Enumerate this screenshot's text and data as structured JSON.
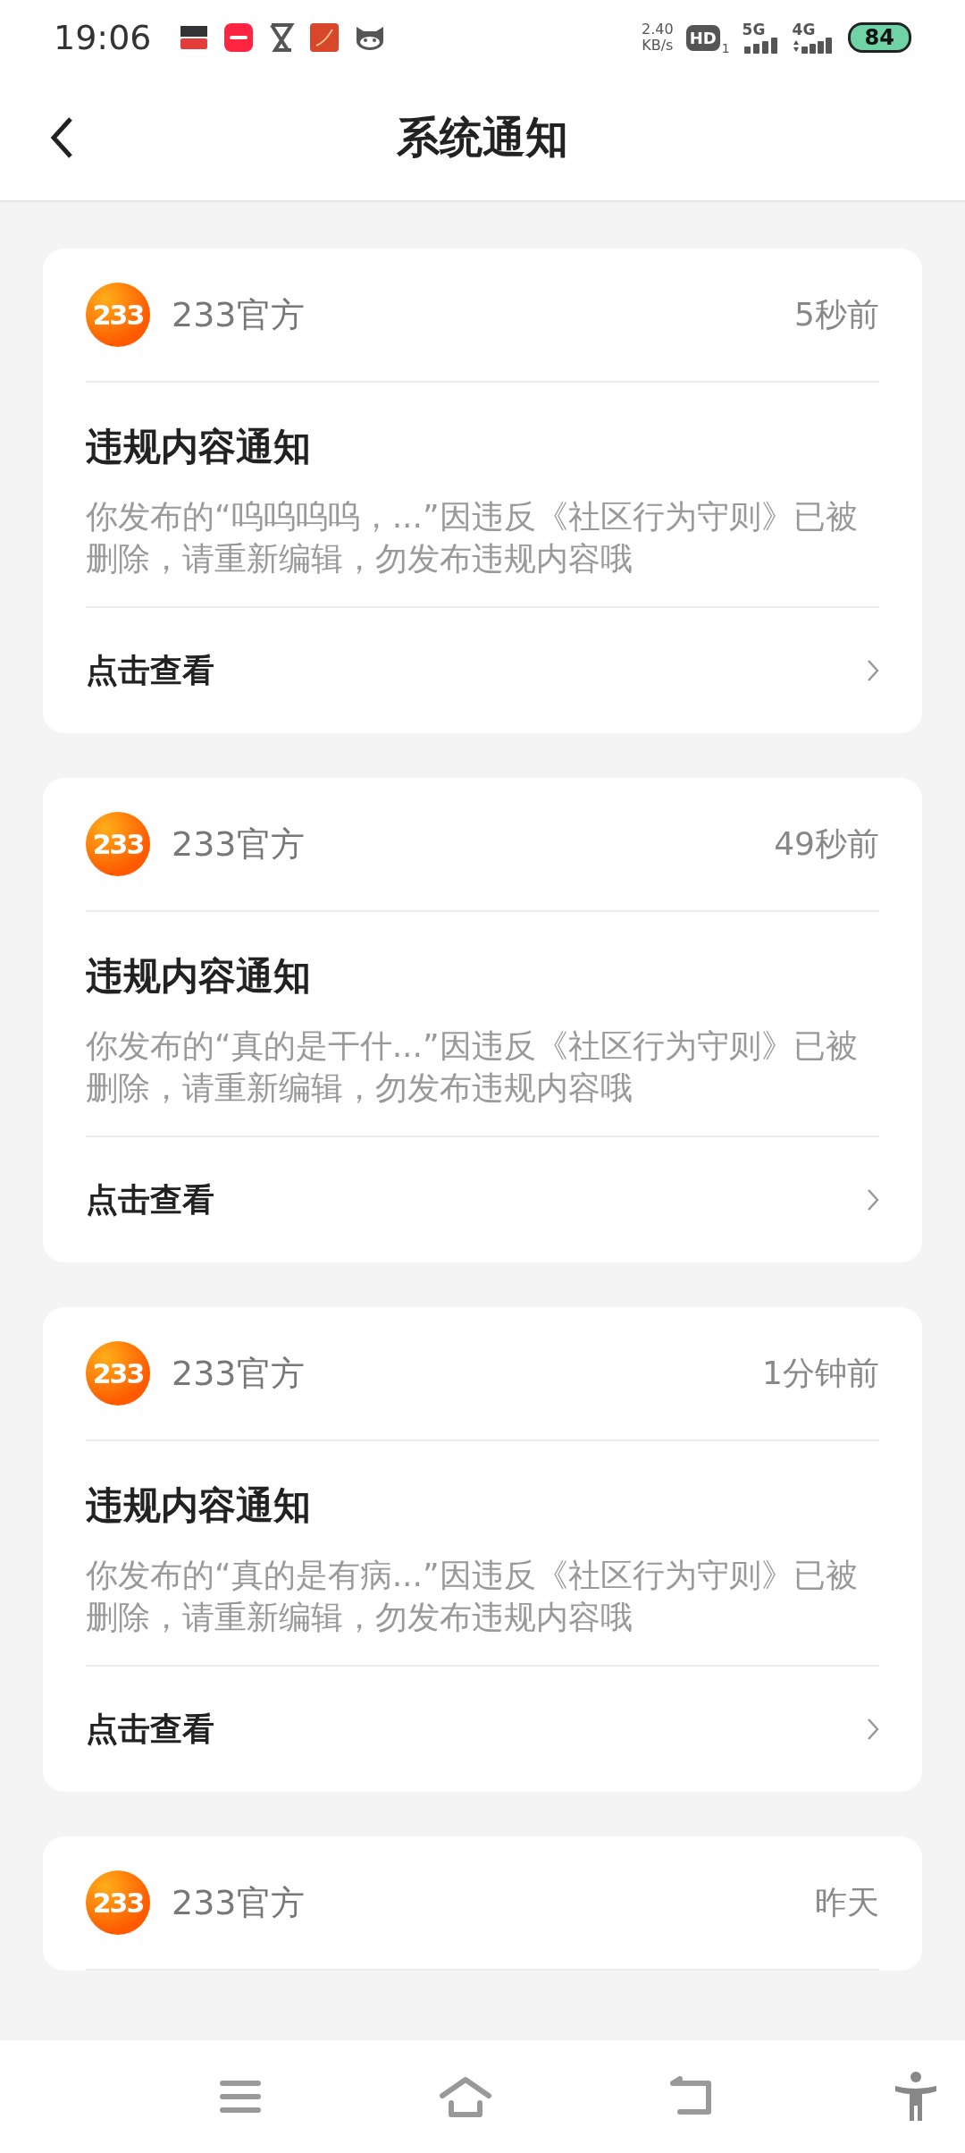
{
  "status_bar": {
    "time": "19:06",
    "net_speed": "2.40",
    "net_unit": "KB/s",
    "hd": "HD",
    "hd_sim": "1",
    "sig1": "5G",
    "sig2": "4G",
    "battery": "84"
  },
  "header": {
    "title": "系统通知"
  },
  "notifications": [
    {
      "logo_text": "233",
      "sender": "233官方",
      "time": "5秒前",
      "title": "违规内容通知",
      "body": "你发布的“呜呜呜呜，...”因违反《社区行为守则》已被删除，请重新编辑，勿发布违规内容哦",
      "action": "点击查看"
    },
    {
      "logo_text": "233",
      "sender": "233官方",
      "time": "49秒前",
      "title": "违规内容通知",
      "body": "你发布的“真的是干什...”因违反《社区行为守则》已被删除，请重新编辑，勿发布违规内容哦",
      "action": "点击查看"
    },
    {
      "logo_text": "233",
      "sender": "233官方",
      "time": "1分钟前",
      "title": "违规内容通知",
      "body": "你发布的“真的是有病...”因违反《社区行为守则》已被删除，请重新编辑，勿发布违规内容哦",
      "action": "点击查看"
    },
    {
      "logo_text": "233",
      "sender": "233官方",
      "time": "昨天"
    }
  ]
}
